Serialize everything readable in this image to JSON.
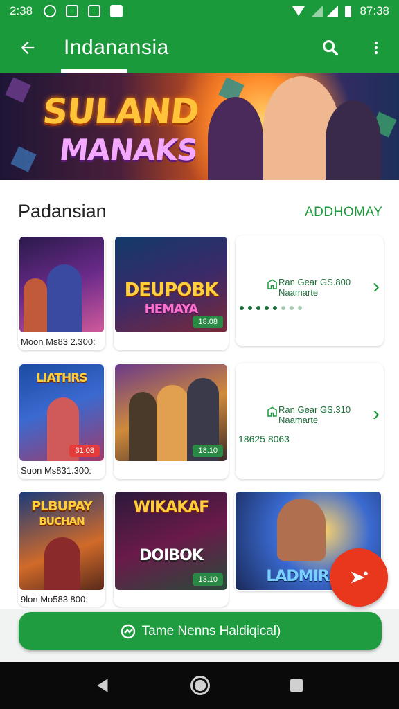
{
  "status_bar": {
    "time": "2:38",
    "right_time": "87:38"
  },
  "app_bar": {
    "title": "Indanansia"
  },
  "banner": {
    "line1": "SULAND",
    "line2": "MANAKS"
  },
  "section": {
    "title": "Padansian",
    "link": "ADDHOMAY"
  },
  "rows": [
    {
      "tiles": [
        {
          "caption": "Moon Ms83 2.300:",
          "art_title": "",
          "pill": ""
        },
        {
          "caption": "",
          "art_title": "DEUPOBK",
          "art_sub": "HEMAYA",
          "pill": "18.08"
        }
      ],
      "info": {
        "line1": "Ran Gear GS.800",
        "line2": "Naamarte",
        "extra": ""
      }
    },
    {
      "tiles": [
        {
          "caption": "Suon Ms831.300:",
          "art_title": "LIATHRS",
          "pill": "31.08"
        },
        {
          "caption": "",
          "art_title": "",
          "pill": "18.10"
        }
      ],
      "info": {
        "line1": "Ran Gear GS.310",
        "line2": "Naamarte",
        "extra": "18625 8063"
      }
    },
    {
      "tiles": [
        {
          "caption": "9lon Mo583 800:",
          "art_title": "PLBUPAY",
          "art_sub": "BUCHAN",
          "pill": ""
        },
        {
          "caption": "",
          "art_title": "WIKAKAF",
          "art_sub": "DOIBOK",
          "pill": "13.10"
        },
        {
          "caption": "",
          "art_title": "LADMIRAS",
          "pill": ""
        }
      ]
    }
  ],
  "cta": {
    "label": "Tame Nenns Haldiqical)"
  },
  "colors": {
    "primary": "#1b9a3b",
    "fab": "#e8371d",
    "link": "#1b9a3b"
  },
  "icons": [
    "back-arrow-icon",
    "search-icon",
    "more-vert-icon",
    "chevron-right-icon",
    "play-icon",
    "sync-icon",
    "nav-back-icon",
    "nav-home-icon",
    "nav-recents-icon"
  ]
}
